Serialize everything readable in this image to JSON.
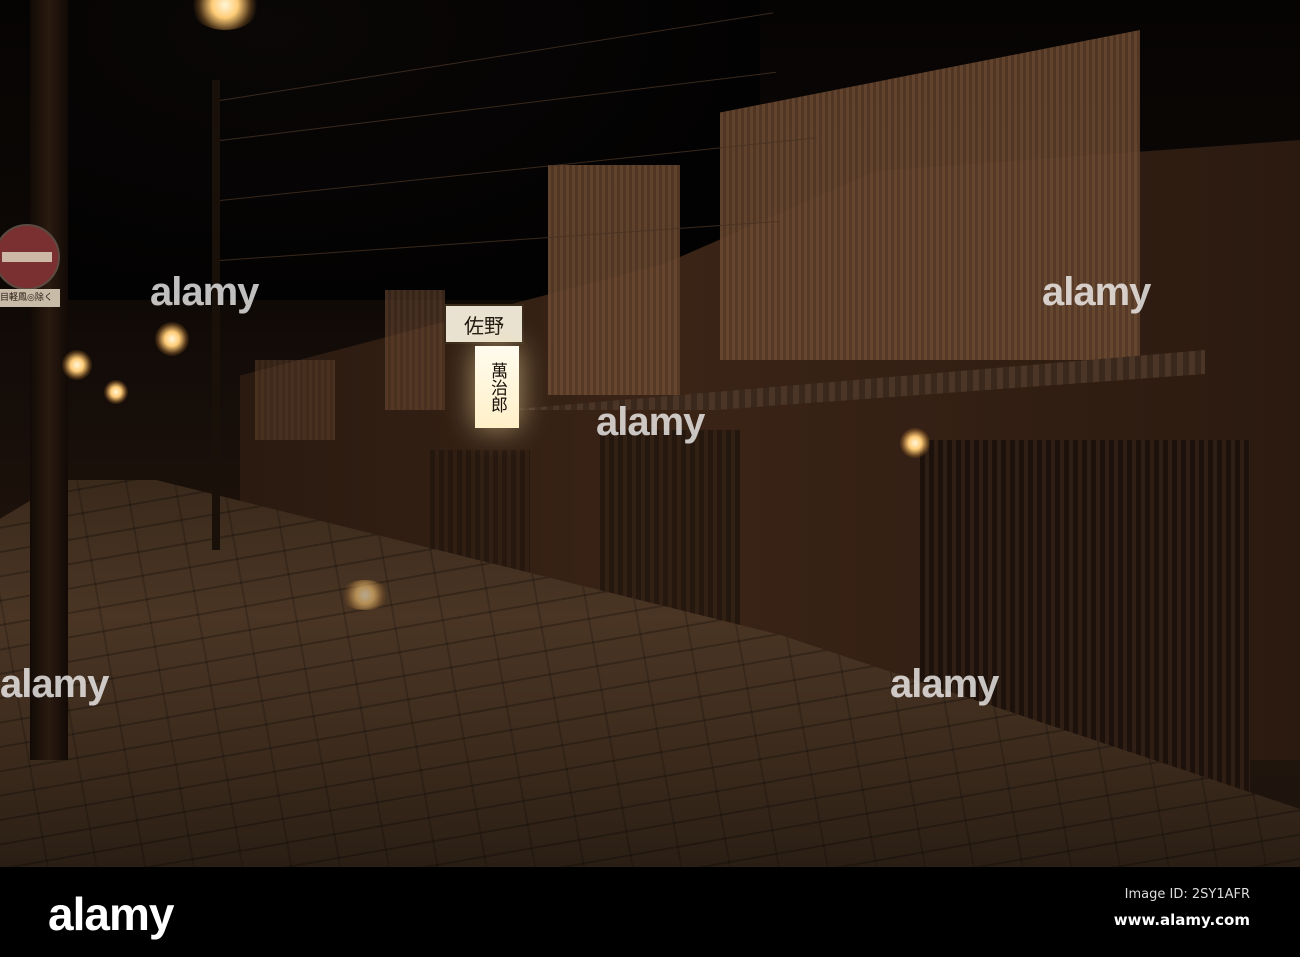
{
  "photo": {
    "description_alt": "Night street with traditional wooden houses",
    "signs": {
      "top_sign": "佐野",
      "lit_sign": "萬治郎",
      "street_plate": "目軽鳳◎除く"
    },
    "watermark": "alamy"
  },
  "footer": {
    "logo": "alamy",
    "image_id": "Image ID: 2SY1AFR",
    "website": "www.alamy.com"
  }
}
